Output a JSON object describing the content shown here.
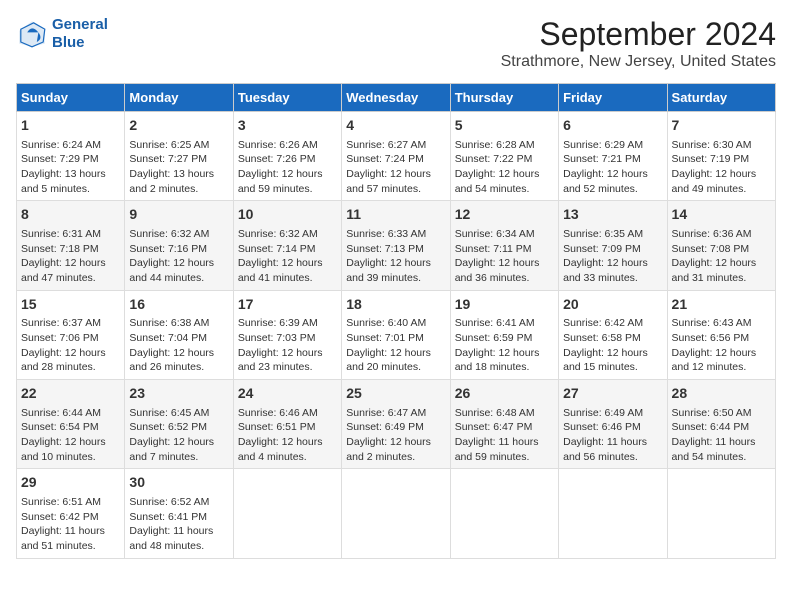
{
  "logo": {
    "line1": "General",
    "line2": "Blue"
  },
  "title": "September 2024",
  "subtitle": "Strathmore, New Jersey, United States",
  "days_of_week": [
    "Sunday",
    "Monday",
    "Tuesday",
    "Wednesday",
    "Thursday",
    "Friday",
    "Saturday"
  ],
  "weeks": [
    [
      {
        "day": 1,
        "info": "Sunrise: 6:24 AM\nSunset: 7:29 PM\nDaylight: 13 hours\nand 5 minutes."
      },
      {
        "day": 2,
        "info": "Sunrise: 6:25 AM\nSunset: 7:27 PM\nDaylight: 13 hours\nand 2 minutes."
      },
      {
        "day": 3,
        "info": "Sunrise: 6:26 AM\nSunset: 7:26 PM\nDaylight: 12 hours\nand 59 minutes."
      },
      {
        "day": 4,
        "info": "Sunrise: 6:27 AM\nSunset: 7:24 PM\nDaylight: 12 hours\nand 57 minutes."
      },
      {
        "day": 5,
        "info": "Sunrise: 6:28 AM\nSunset: 7:22 PM\nDaylight: 12 hours\nand 54 minutes."
      },
      {
        "day": 6,
        "info": "Sunrise: 6:29 AM\nSunset: 7:21 PM\nDaylight: 12 hours\nand 52 minutes."
      },
      {
        "day": 7,
        "info": "Sunrise: 6:30 AM\nSunset: 7:19 PM\nDaylight: 12 hours\nand 49 minutes."
      }
    ],
    [
      {
        "day": 8,
        "info": "Sunrise: 6:31 AM\nSunset: 7:18 PM\nDaylight: 12 hours\nand 47 minutes."
      },
      {
        "day": 9,
        "info": "Sunrise: 6:32 AM\nSunset: 7:16 PM\nDaylight: 12 hours\nand 44 minutes."
      },
      {
        "day": 10,
        "info": "Sunrise: 6:32 AM\nSunset: 7:14 PM\nDaylight: 12 hours\nand 41 minutes."
      },
      {
        "day": 11,
        "info": "Sunrise: 6:33 AM\nSunset: 7:13 PM\nDaylight: 12 hours\nand 39 minutes."
      },
      {
        "day": 12,
        "info": "Sunrise: 6:34 AM\nSunset: 7:11 PM\nDaylight: 12 hours\nand 36 minutes."
      },
      {
        "day": 13,
        "info": "Sunrise: 6:35 AM\nSunset: 7:09 PM\nDaylight: 12 hours\nand 33 minutes."
      },
      {
        "day": 14,
        "info": "Sunrise: 6:36 AM\nSunset: 7:08 PM\nDaylight: 12 hours\nand 31 minutes."
      }
    ],
    [
      {
        "day": 15,
        "info": "Sunrise: 6:37 AM\nSunset: 7:06 PM\nDaylight: 12 hours\nand 28 minutes."
      },
      {
        "day": 16,
        "info": "Sunrise: 6:38 AM\nSunset: 7:04 PM\nDaylight: 12 hours\nand 26 minutes."
      },
      {
        "day": 17,
        "info": "Sunrise: 6:39 AM\nSunset: 7:03 PM\nDaylight: 12 hours\nand 23 minutes."
      },
      {
        "day": 18,
        "info": "Sunrise: 6:40 AM\nSunset: 7:01 PM\nDaylight: 12 hours\nand 20 minutes."
      },
      {
        "day": 19,
        "info": "Sunrise: 6:41 AM\nSunset: 6:59 PM\nDaylight: 12 hours\nand 18 minutes."
      },
      {
        "day": 20,
        "info": "Sunrise: 6:42 AM\nSunset: 6:58 PM\nDaylight: 12 hours\nand 15 minutes."
      },
      {
        "day": 21,
        "info": "Sunrise: 6:43 AM\nSunset: 6:56 PM\nDaylight: 12 hours\nand 12 minutes."
      }
    ],
    [
      {
        "day": 22,
        "info": "Sunrise: 6:44 AM\nSunset: 6:54 PM\nDaylight: 12 hours\nand 10 minutes."
      },
      {
        "day": 23,
        "info": "Sunrise: 6:45 AM\nSunset: 6:52 PM\nDaylight: 12 hours\nand 7 minutes."
      },
      {
        "day": 24,
        "info": "Sunrise: 6:46 AM\nSunset: 6:51 PM\nDaylight: 12 hours\nand 4 minutes."
      },
      {
        "day": 25,
        "info": "Sunrise: 6:47 AM\nSunset: 6:49 PM\nDaylight: 12 hours\nand 2 minutes."
      },
      {
        "day": 26,
        "info": "Sunrise: 6:48 AM\nSunset: 6:47 PM\nDaylight: 11 hours\nand 59 minutes."
      },
      {
        "day": 27,
        "info": "Sunrise: 6:49 AM\nSunset: 6:46 PM\nDaylight: 11 hours\nand 56 minutes."
      },
      {
        "day": 28,
        "info": "Sunrise: 6:50 AM\nSunset: 6:44 PM\nDaylight: 11 hours\nand 54 minutes."
      }
    ],
    [
      {
        "day": 29,
        "info": "Sunrise: 6:51 AM\nSunset: 6:42 PM\nDaylight: 11 hours\nand 51 minutes."
      },
      {
        "day": 30,
        "info": "Sunrise: 6:52 AM\nSunset: 6:41 PM\nDaylight: 11 hours\nand 48 minutes."
      },
      {
        "day": null,
        "info": ""
      },
      {
        "day": null,
        "info": ""
      },
      {
        "day": null,
        "info": ""
      },
      {
        "day": null,
        "info": ""
      },
      {
        "day": null,
        "info": ""
      }
    ]
  ]
}
